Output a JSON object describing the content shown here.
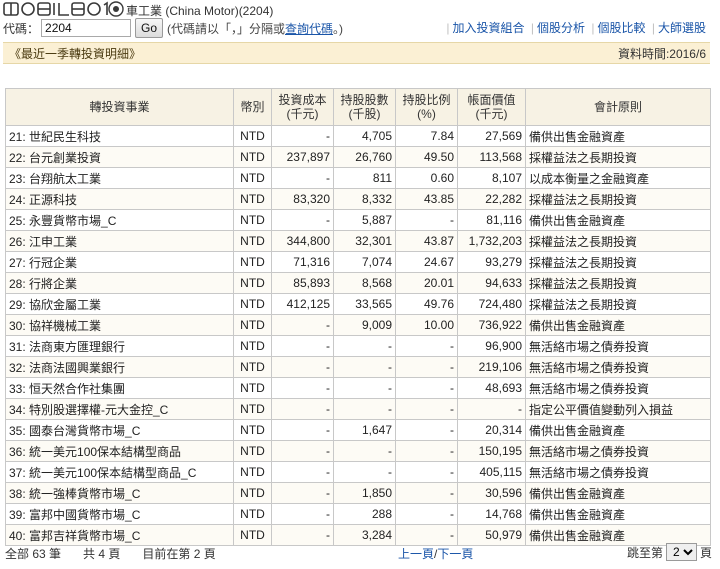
{
  "header": {
    "company_title": "車工業 (China Motor)(2204)",
    "code_label": "代碼：",
    "code_value": "2204",
    "go_label": "Go",
    "hint_prefix": "(代碼請以「，」分隔或",
    "hint_link": "查詢代碼",
    "hint_suffix": "。)",
    "nav": [
      "加入投資組合",
      "個股分析",
      "個股比較",
      "大師選股"
    ]
  },
  "section": {
    "title": "《最近一季轉投資明細》",
    "date": "資料時間:2016/6"
  },
  "table": {
    "headers": [
      "轉投資事業",
      "幣別",
      "投資成本\n(千元)",
      "持股股數\n(千股)",
      "持股比例\n(%)",
      "帳面價值\n(千元)",
      "會計原則"
    ],
    "rows": [
      [
        "21: 世紀民生科技",
        "NTD",
        "-",
        "4,705",
        "7.84",
        "27,569",
        "備供出售金融資產"
      ],
      [
        "22: 台元創業投資",
        "NTD",
        "237,897",
        "26,760",
        "49.50",
        "113,568",
        "採權益法之長期投資"
      ],
      [
        "23: 台翔航太工業",
        "NTD",
        "-",
        "811",
        "0.60",
        "8,107",
        "以成本衡量之金融資產"
      ],
      [
        "24: 正源科技",
        "NTD",
        "83,320",
        "8,332",
        "43.85",
        "22,282",
        "採權益法之長期投資"
      ],
      [
        "25: 永豐貨幣市場_C",
        "NTD",
        "-",
        "5,887",
        "-",
        "81,116",
        "備供出售金融資產"
      ],
      [
        "26: 江申工業",
        "NTD",
        "344,800",
        "32,301",
        "43.87",
        "1,732,203",
        "採權益法之長期投資"
      ],
      [
        "27: 行冠企業",
        "NTD",
        "71,316",
        "7,074",
        "24.67",
        "93,279",
        "採權益法之長期投資"
      ],
      [
        "28: 行將企業",
        "NTD",
        "85,893",
        "8,568",
        "20.01",
        "94,633",
        "採權益法之長期投資"
      ],
      [
        "29: 協欣金屬工業",
        "NTD",
        "412,125",
        "33,565",
        "49.76",
        "724,480",
        "採權益法之長期投資"
      ],
      [
        "30: 協祥機械工業",
        "NTD",
        "-",
        "9,009",
        "10.00",
        "736,922",
        "備供出售金融資產"
      ],
      [
        "31: 法商東方匯理銀行",
        "NTD",
        "-",
        "-",
        "-",
        "96,900",
        "無活絡市場之債券投資"
      ],
      [
        "32: 法商法國興業銀行",
        "NTD",
        "-",
        "-",
        "-",
        "219,106",
        "無活絡市場之債券投資"
      ],
      [
        "33: 恒天然合作社集團",
        "NTD",
        "-",
        "-",
        "-",
        "48,693",
        "無活絡市場之債券投資"
      ],
      [
        "34: 特別股選擇權-元大金控_C",
        "NTD",
        "-",
        "-",
        "-",
        "-",
        "指定公平價值變動列入損益"
      ],
      [
        "35: 國泰台灣貨幣市場_C",
        "NTD",
        "-",
        "1,647",
        "-",
        "20,314",
        "備供出售金融資產"
      ],
      [
        "36: 統一美元100保本結構型商品",
        "NTD",
        "-",
        "-",
        "-",
        "150,195",
        "無活絡市場之債券投資"
      ],
      [
        "37: 統一美元100保本結構型商品_C",
        "NTD",
        "-",
        "-",
        "-",
        "405,115",
        "無活絡市場之債券投資"
      ],
      [
        "38: 統一強棒貨幣市場_C",
        "NTD",
        "-",
        "1,850",
        "-",
        "30,596",
        "備供出售金融資產"
      ],
      [
        "39: 富邦中國貨幣市場_C",
        "NTD",
        "-",
        "288",
        "-",
        "14,768",
        "備供出售金融資產"
      ],
      [
        "40: 富邦吉祥貨幣市場_C",
        "NTD",
        "-",
        "3,284",
        "-",
        "50,979",
        "備供出售金融資產"
      ]
    ]
  },
  "footer": {
    "total": "全部 63 筆",
    "pages": "共 4 頁",
    "current": "目前在第 2 頁",
    "prev_link": "上一頁",
    "slash": "/",
    "next_link": "下一頁",
    "jump_label": "跳至第",
    "jump_value": "2",
    "jump_suffix": "頁"
  }
}
